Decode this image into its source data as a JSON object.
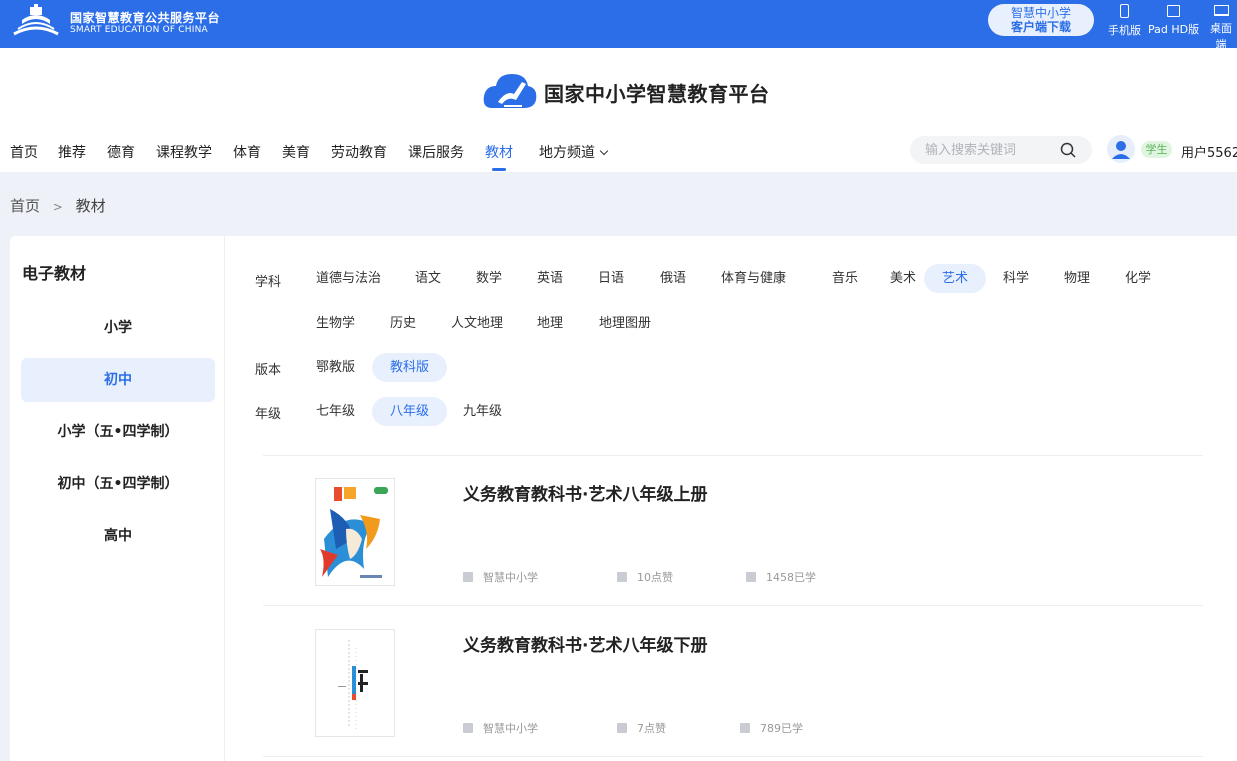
{
  "topbar": {
    "title": "国家智慧教育公共服务平台",
    "subtitle": "SMART EDUCATION OF CHINA",
    "client_line1": "智慧中小学",
    "client_line2": "客户端下载",
    "devices": [
      "手机版",
      "Pad HD版",
      "桌面端"
    ]
  },
  "header": {
    "brand": "国家中小学智慧教育平台",
    "nav": [
      "首页",
      "推荐",
      "德育",
      "课程教学",
      "体育",
      "美育",
      "劳动教育",
      "课后服务",
      "教材",
      "地方频道"
    ],
    "active_nav": "教材",
    "search_placeholder": "输入搜索关键词",
    "role_badge": "学生",
    "username": "用户5562"
  },
  "breadcrumb": {
    "home": "首页",
    "separator": ">",
    "current": "教材"
  },
  "sidebar": {
    "title": "电子教材",
    "items": [
      "小学",
      "初中",
      "小学（五•四学制）",
      "初中（五•四学制）",
      "高中"
    ],
    "active": "初中"
  },
  "filters": {
    "subject_label": "学科",
    "subjects_row1": [
      "道德与法治",
      "语文",
      "数学",
      "英语",
      "日语",
      "俄语",
      "体育与健康",
      "音乐",
      "美术",
      "艺术",
      "科学",
      "物理",
      "化学"
    ],
    "subjects_row2": [
      "生物学",
      "历史",
      "人文地理",
      "地理",
      "地理图册"
    ],
    "active_subject": "艺术",
    "edition_label": "版本",
    "editions": [
      "鄂教版",
      "教科版"
    ],
    "active_edition": "教科版",
    "grade_label": "年级",
    "grades": [
      "七年级",
      "八年级",
      "九年级"
    ],
    "active_grade": "八年级"
  },
  "books": [
    {
      "title": "义务教育教科书·艺术八年级上册",
      "source": "智慧中小学",
      "likes": "10点赞",
      "learners": "1458已学"
    },
    {
      "title": "义务教育教科书·艺术八年级下册",
      "source": "智慧中小学",
      "likes": "7点赞",
      "learners": "789已学"
    }
  ],
  "colors": {
    "primary": "#2b6ee8",
    "active_bg": "#e8f0fe",
    "badge_bg": "#dff5df",
    "badge_text": "#5bb35b"
  }
}
